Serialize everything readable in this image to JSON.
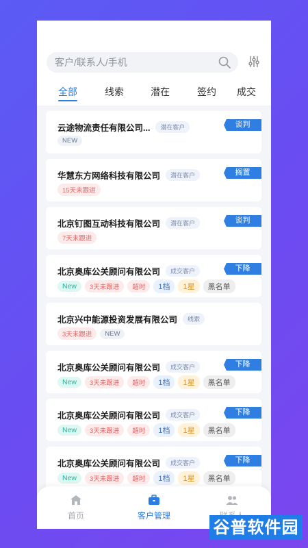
{
  "search": {
    "placeholder": "客户/联系人/手机"
  },
  "tabs": [
    {
      "label": "全部"
    },
    {
      "label": "线索"
    },
    {
      "label": "潜在"
    },
    {
      "label": "签约"
    },
    {
      "label": "成交"
    }
  ],
  "active_tab": "全部",
  "customers": [
    {
      "name": "云途物流责任有限公司...",
      "type": "潜在客户",
      "status": "谈判",
      "tags": [
        "NEW"
      ]
    },
    {
      "name": "华慧东方网络科技有限公司",
      "type": "潜在客户",
      "status": "搁置",
      "tags": [
        "15天未跟进"
      ]
    },
    {
      "name": "北京钉图互动科技有限公司",
      "type": "潜在客户",
      "status": "谈判",
      "tags": [
        "7天未跟进"
      ]
    },
    {
      "name": "北京奥库公关顾问有限公司",
      "type": "成交客户",
      "status": "下降",
      "tags": [
        "New",
        "3天未跟进",
        "超时",
        "1档",
        "1星",
        "黑名单"
      ]
    },
    {
      "name": "北京兴中能源投资发展有限公司",
      "type": "线索",
      "status": "",
      "tags": [
        "3天未跟进",
        "NEW"
      ]
    },
    {
      "name": "北京奥库公关顾问有限公司",
      "type": "成交客户",
      "status": "下降",
      "tags": [
        "New",
        "3天未跟进",
        "超时",
        "1档",
        "1星",
        "黑名单"
      ]
    },
    {
      "name": "北京奥库公关顾问有限公司",
      "type": "成交客户",
      "status": "下降",
      "tags": [
        "New",
        "3天未跟进",
        "超时",
        "1档",
        "1星",
        "黑名单"
      ]
    },
    {
      "name": "北京奥库公关顾问有限公司",
      "type": "成交客户",
      "status": "下降",
      "tags": [
        "New",
        "3天未跟进",
        "超时",
        "1档",
        "1星",
        "黑名单"
      ]
    }
  ],
  "bottom_nav": [
    {
      "label": "首页",
      "icon": "home-icon",
      "active": false
    },
    {
      "label": "客户管理",
      "icon": "briefcase-icon",
      "active": true
    },
    {
      "label": "联系人",
      "icon": "contacts-icon",
      "active": false
    }
  ],
  "watermark": "谷普软件园",
  "colors": {
    "accent": "#2b7de0",
    "background_gradient_start": "#5b5bf5",
    "background_gradient_end": "#7b46ee",
    "nav_inactive": "#a7abb3",
    "watermark": "#1e7de6"
  }
}
